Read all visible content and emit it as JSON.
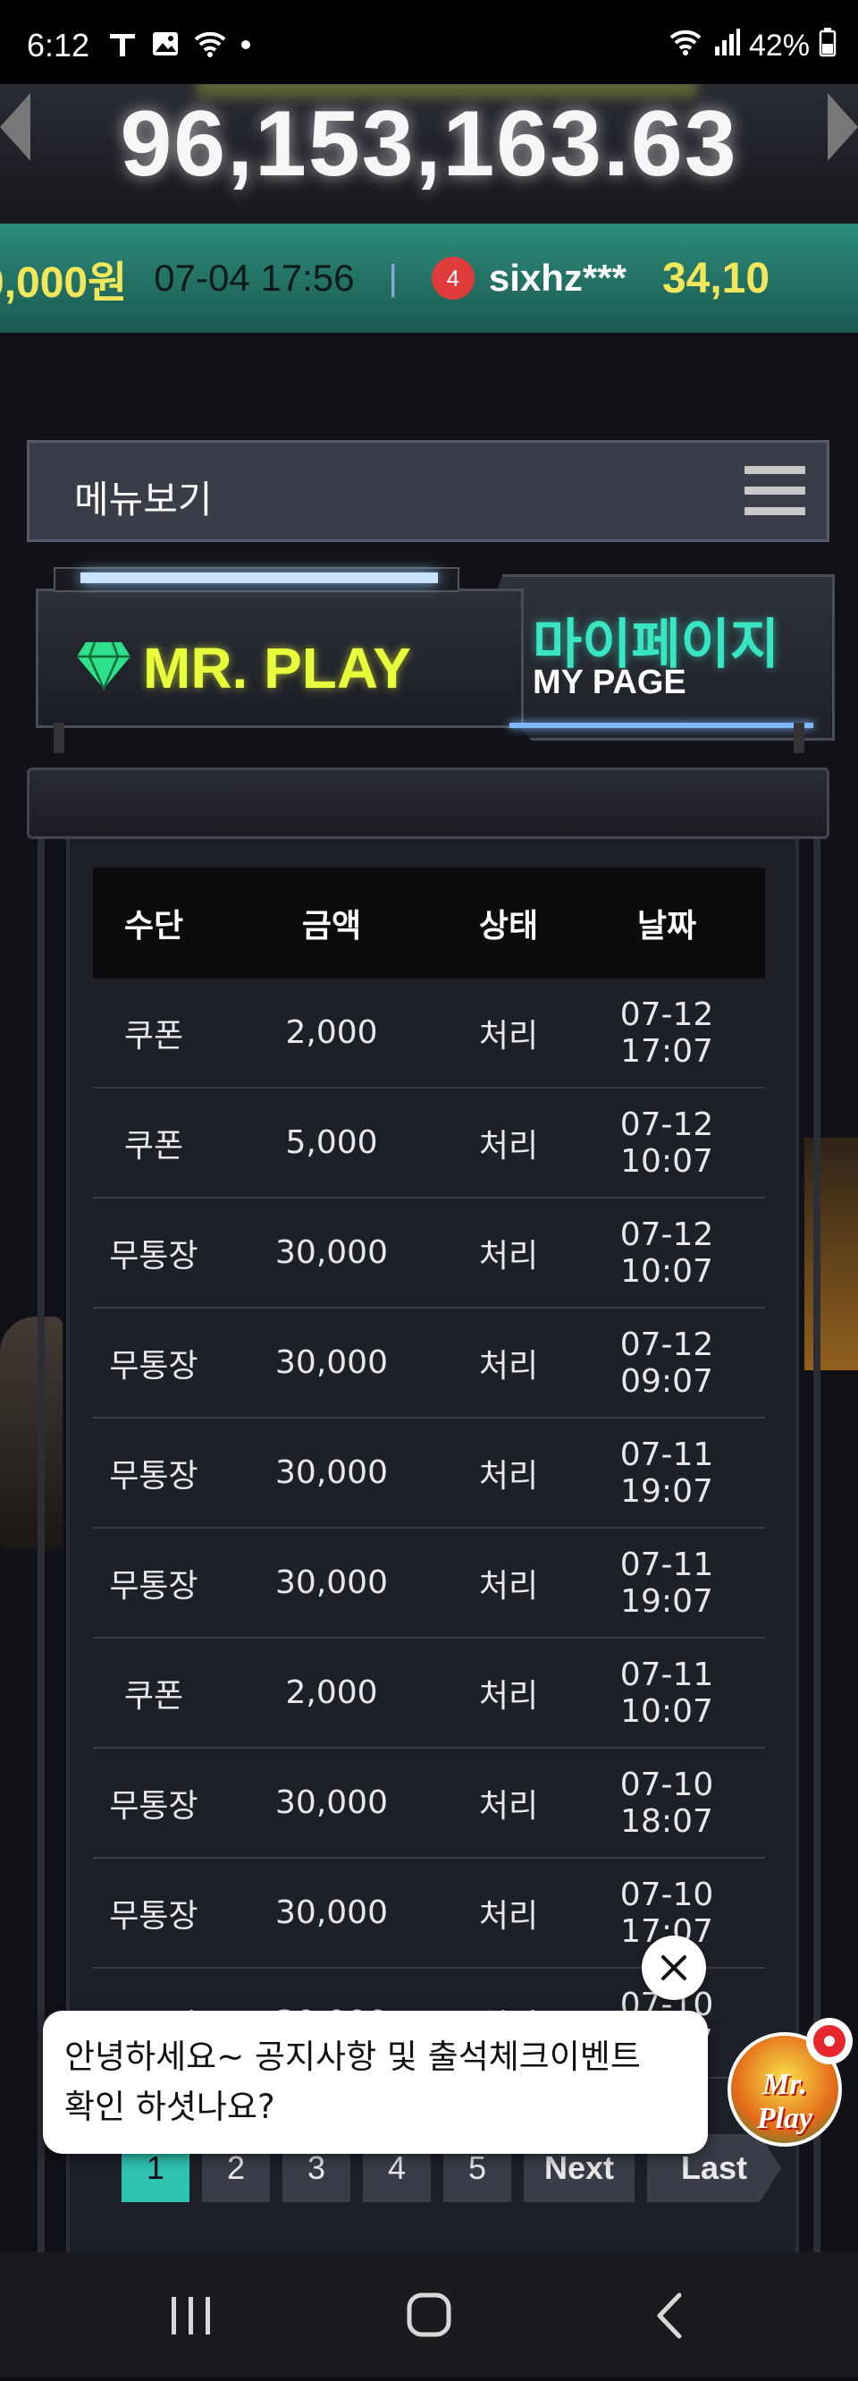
{
  "status_bar": {
    "time": "6:12",
    "battery": "42%",
    "icons_left": [
      "t-icon",
      "image-icon",
      "wifi-icon",
      "dot-icon"
    ],
    "icons_right": [
      "wifi-icon",
      "signal-icon",
      "battery-icon"
    ]
  },
  "jackpot": {
    "amount": "96,153,163.63"
  },
  "ticker": {
    "amount_prev": "0,000원",
    "date": "07-04 17:56",
    "separator": "|",
    "rank": "4",
    "user": "sixhz***",
    "amount_next": "34,10"
  },
  "menu": {
    "label": "메뉴보기"
  },
  "sign": {
    "brand": "MR. PLAY",
    "title_kr": "마이페이지",
    "title_en": "MY PAGE"
  },
  "table": {
    "headers": [
      "수단",
      "금액",
      "상태",
      "날짜"
    ],
    "rows": [
      [
        "쿠폰",
        "2,000",
        "처리",
        "07-12 17:07"
      ],
      [
        "쿠폰",
        "5,000",
        "처리",
        "07-12 10:07"
      ],
      [
        "무통장",
        "30,000",
        "처리",
        "07-12 10:07"
      ],
      [
        "무통장",
        "30,000",
        "처리",
        "07-12 09:07"
      ],
      [
        "무통장",
        "30,000",
        "처리",
        "07-11 19:07"
      ],
      [
        "무통장",
        "30,000",
        "처리",
        "07-11 19:07"
      ],
      [
        "쿠폰",
        "2,000",
        "처리",
        "07-11 10:07"
      ],
      [
        "무통장",
        "30,000",
        "처리",
        "07-10 18:07"
      ],
      [
        "무통장",
        "30,000",
        "처리",
        "07-10 17:07"
      ],
      [
        "무통장",
        "30,000",
        "처리",
        "07-10 17:07"
      ]
    ]
  },
  "pager": {
    "pages": [
      "1",
      "2",
      "3",
      "4",
      "5"
    ],
    "next": "Next",
    "last": "Last",
    "current": "1"
  },
  "chat": {
    "message_line1": "안녕하세요~ 공지사항 및 출석체크이벤트",
    "message_line2": "확인 하셧나요?",
    "avatar_text": "Mr. Play"
  },
  "colors": {
    "accent": "#2fc4b2",
    "brand_yellow": "#e9ff3c",
    "ticker_bg": "#2d8c7b"
  }
}
